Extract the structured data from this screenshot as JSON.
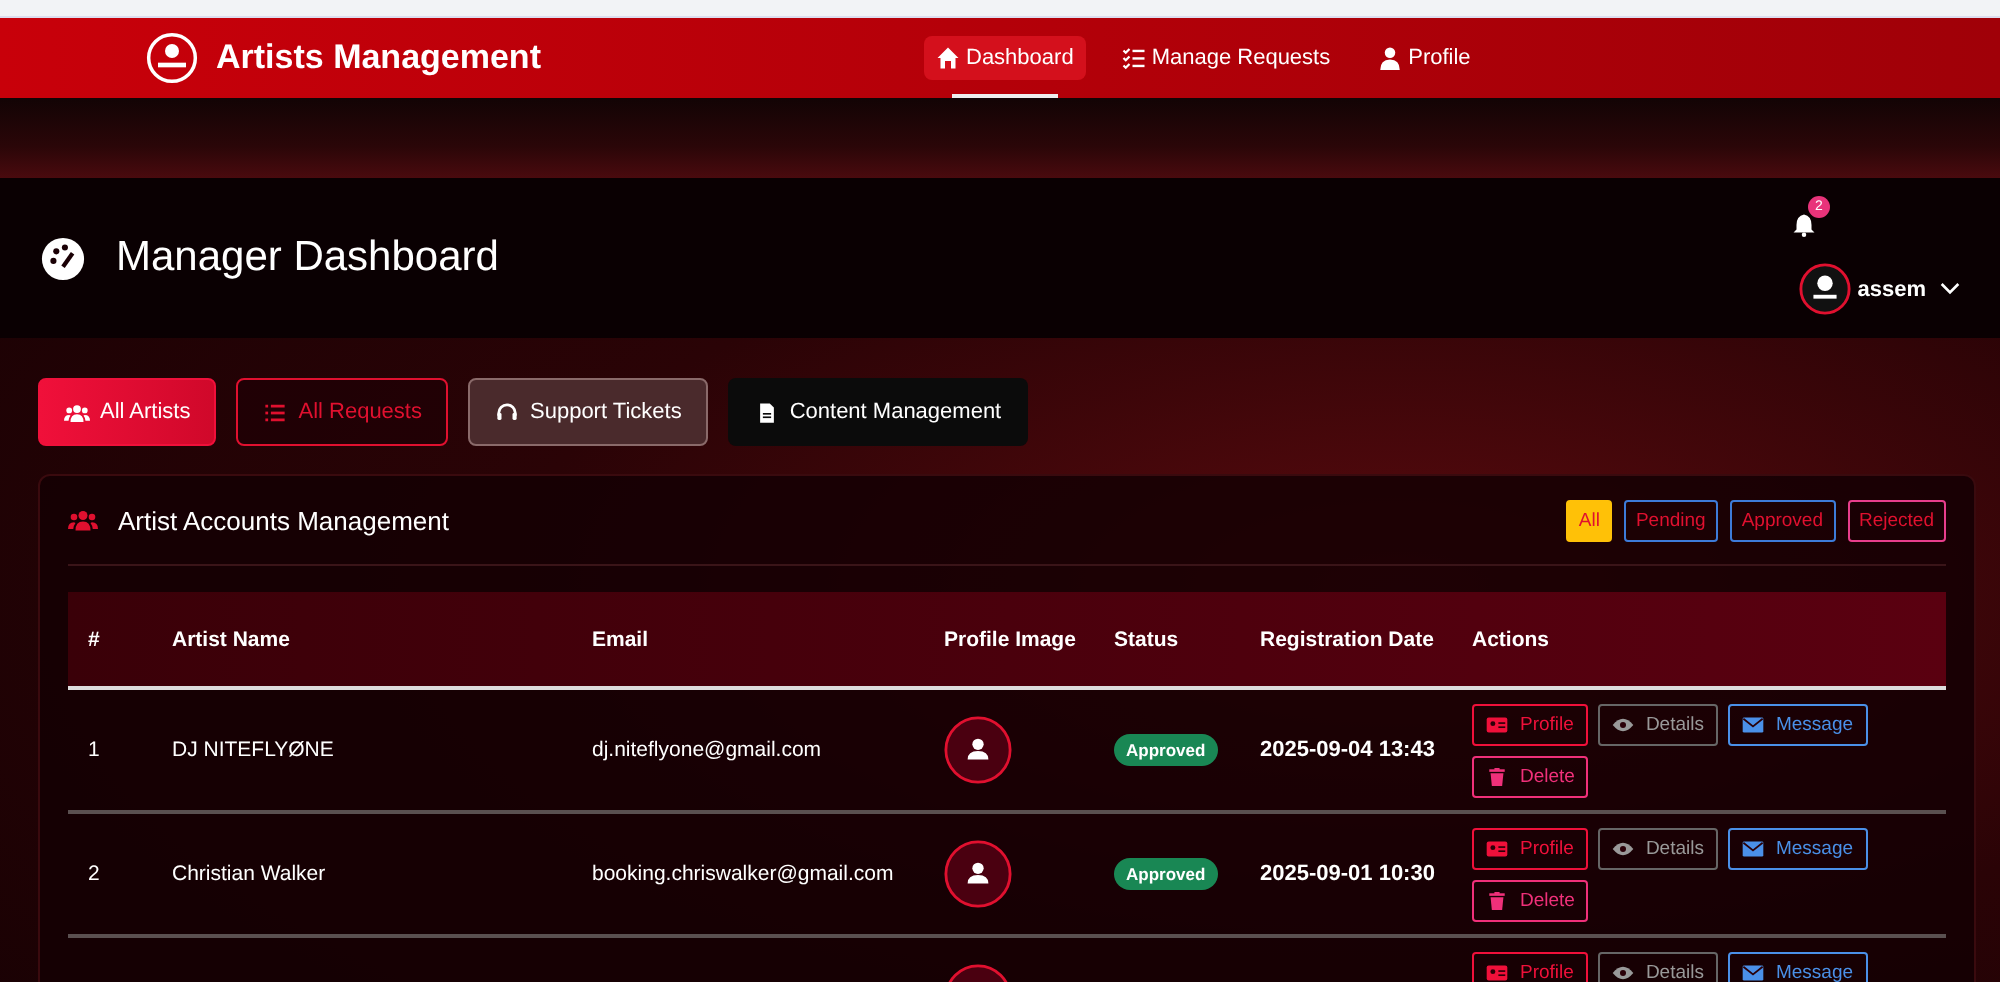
{
  "navbar": {
    "brand": "Artists Management",
    "links": [
      {
        "label": "Dashboard",
        "selected": true
      },
      {
        "label": "Manage Requests",
        "selected": false
      },
      {
        "label": "Profile",
        "selected": false
      }
    ]
  },
  "header": {
    "title": "Manager Dashboard",
    "notifications": "2",
    "user": "assem"
  },
  "tabs": [
    {
      "label": "All Artists",
      "kind": "solid",
      "selected": true
    },
    {
      "label": "All Requests",
      "kind": "outline",
      "selected": false
    },
    {
      "label": "Support Tickets",
      "kind": "muted",
      "selected": false
    },
    {
      "label": "Content Management",
      "kind": "dark",
      "selected": false
    }
  ],
  "card": {
    "title": "Artist Accounts Management",
    "filters": [
      {
        "label": "All",
        "selected": true,
        "color": "#ffc107"
      },
      {
        "label": "Pending",
        "selected": false,
        "color": "#3d7bd9"
      },
      {
        "label": "Approved",
        "selected": false,
        "color": "#3d7bd9"
      },
      {
        "label": "Rejected",
        "selected": false,
        "color": "#e83e8c"
      }
    ],
    "table": {
      "columns": [
        "#",
        "Artist Name",
        "Email",
        "Profile Image",
        "Status",
        "Registration Date",
        "Actions"
      ],
      "rows": [
        {
          "index": "1",
          "name": "DJ NITEFLYØNE",
          "email": "dj.niteflyone@gmail.com",
          "status": "Approved",
          "date": "2025-09-04 13:43",
          "actions": [
            "Profile",
            "Details",
            "Message",
            "Delete"
          ]
        },
        {
          "index": "2",
          "name": "Christian Walker",
          "email": "booking.chriswalker@gmail.com",
          "status": "Approved",
          "date": "2025-09-01 10:30",
          "actions": [
            "Profile",
            "Details",
            "Message",
            "Delete"
          ]
        },
        {
          "actions": [
            "Profile",
            "Details",
            "Message"
          ]
        }
      ]
    }
  }
}
